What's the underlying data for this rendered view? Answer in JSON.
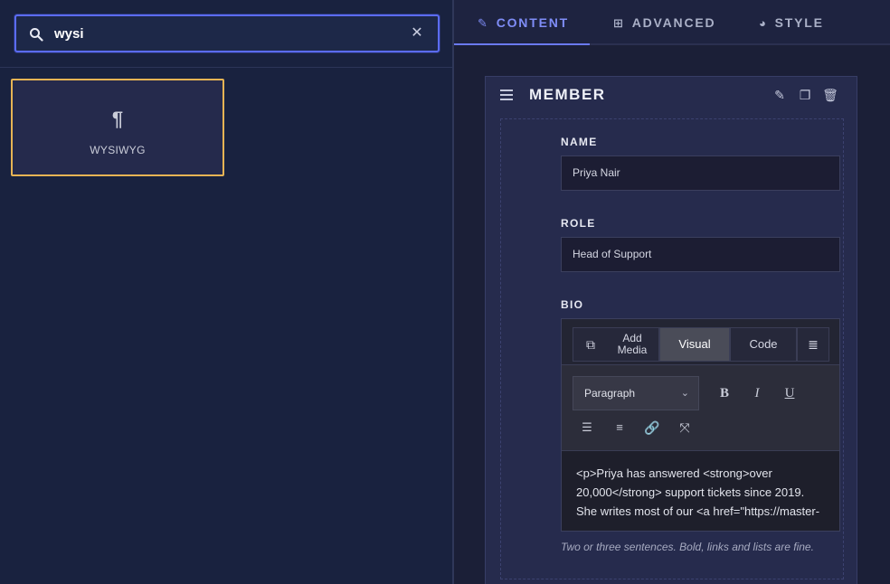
{
  "search": {
    "value": "wysi",
    "icon": "search-icon",
    "clear_icon": "close-icon"
  },
  "widget": {
    "icon": "¶",
    "label": "WYSIWYG"
  },
  "tabs": [
    {
      "label": "CONTENT",
      "icon": "pencil-icon",
      "active": true
    },
    {
      "label": "ADVANCED",
      "icon": "grid-icon",
      "active": false
    },
    {
      "label": "STYLE",
      "icon": "palette-icon",
      "active": false
    }
  ],
  "card": {
    "title": "MEMBER"
  },
  "fields": {
    "name": {
      "label": "NAME",
      "value": "Priya Nair"
    },
    "role": {
      "label": "ROLE",
      "value": "Head of Support"
    },
    "bio": {
      "label": "BIO",
      "add_media": "Add Media",
      "visual": "Visual",
      "code": "Code",
      "format": "Paragraph",
      "content": "<p>Priya has answered <strong>over 20,000</strong> support tickets since 2019. She writes most of our <a href=\"https://master-",
      "help": "Two or three sentences. Bold, links and lists are fine."
    }
  },
  "toolbar": {
    "bold": "B",
    "italic": "I",
    "underline": "U"
  }
}
